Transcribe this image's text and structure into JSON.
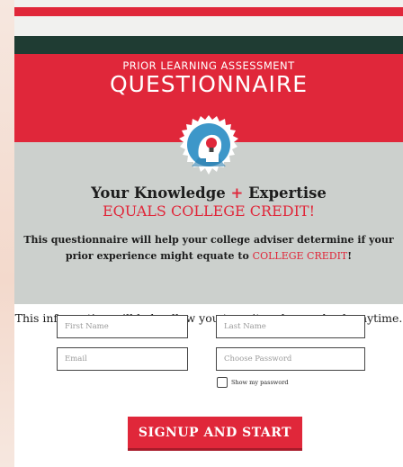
{
  "header": {
    "kicker": "PRIOR LEARNING ASSESSMENT",
    "title": "QUESTIONNAIRE",
    "badge_icon": "lightbulb-head-icon"
  },
  "headline": {
    "part1": "Your Knowledge",
    "plus": "+",
    "part2": "Expertise",
    "subhead": "EQUALS COLLEGE CREDIT!"
  },
  "description": {
    "text": "This questionnaire will help your college adviser determine if your prior experience might equate to",
    "highlight": "COLLEGE CREDIT",
    "end": "!"
  },
  "form": {
    "info": "This information will help allow you to quit and come back anytime.",
    "first_name_placeholder": "First Name",
    "last_name_placeholder": "Last Name",
    "email_placeholder": "Email",
    "password_placeholder": "Choose Password",
    "show_password_label": "Show my password",
    "submit_label": "SIGNUP AND START"
  },
  "colors": {
    "accent": "#e0273a",
    "dark_stripe": "#1f3c33",
    "grey_band": "#ccd0cd"
  }
}
